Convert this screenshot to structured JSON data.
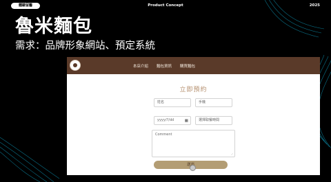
{
  "slide": {
    "tag": "體驗留醫",
    "concept": "Product Concept",
    "year": "2025",
    "title": "魯米麵包",
    "subtitle": "需求：品牌形象網站、預定系統"
  },
  "site": {
    "nav": {
      "items": [
        "本店介紹",
        "麵包資訊",
        "購買麵包"
      ]
    },
    "form": {
      "title": "立即預約",
      "name_placeholder": "姓名",
      "phone_placeholder": "手機",
      "date_value": "yyyy/?/dd",
      "time_placeholder": "選擇取餐時間",
      "comment_placeholder": "Comment",
      "submit_label": "送出"
    }
  },
  "colors": {
    "nav": "#5a3a29",
    "accent": "#b58f6e",
    "button": "#b39d74"
  }
}
